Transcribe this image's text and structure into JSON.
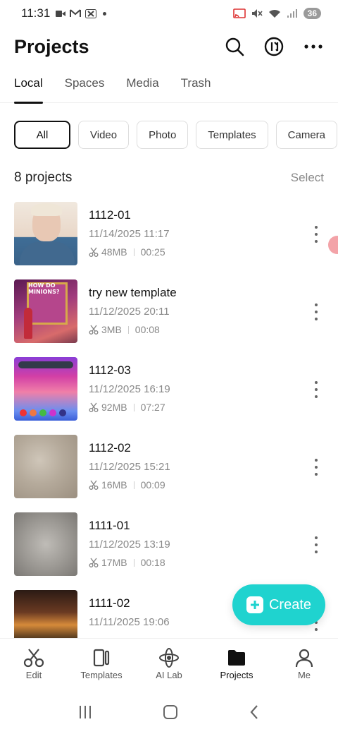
{
  "status_bar": {
    "time": "11:31",
    "left_icons": [
      "video-icon",
      "mail-icon",
      "x-icon",
      "dot-icon"
    ],
    "right_icons": [
      "cast-icon",
      "mute-icon",
      "wifi-icon",
      "signal-icon"
    ],
    "battery": "36"
  },
  "header": {
    "title": "Projects",
    "actions": [
      "search-icon",
      "sort-icon",
      "more-icon"
    ]
  },
  "tabs": [
    {
      "label": "Local",
      "active": true
    },
    {
      "label": "Spaces",
      "active": false
    },
    {
      "label": "Media",
      "active": false
    },
    {
      "label": "Trash",
      "active": false
    }
  ],
  "filters": [
    {
      "label": "All",
      "active": true
    },
    {
      "label": "Video",
      "active": false
    },
    {
      "label": "Photo",
      "active": false
    },
    {
      "label": "Templates",
      "active": false
    },
    {
      "label": "Camera",
      "active": false
    }
  ],
  "list": {
    "count_label": "8 projects",
    "select_label": "Select"
  },
  "projects": [
    {
      "name": "1112-01",
      "date": "11/14/2025 11:17",
      "size": "48MB",
      "duration": "00:25"
    },
    {
      "name": "try new template",
      "date": "11/12/2025 20:11",
      "size": "3MB",
      "duration": "00:08",
      "thumb_caption": "HOW DO MINIONS?"
    },
    {
      "name": "1112-03",
      "date": "11/12/2025 16:19",
      "size": "92MB",
      "duration": "07:27"
    },
    {
      "name": "1112-02",
      "date": "11/12/2025 15:21",
      "size": "16MB",
      "duration": "00:09"
    },
    {
      "name": "1111-01",
      "date": "11/12/2025 13:19",
      "size": "17MB",
      "duration": "00:18"
    },
    {
      "name": "1111-02",
      "date": "11/11/2025 19:06",
      "size": "",
      "duration": ""
    }
  ],
  "fab": {
    "label": "Create",
    "color": "#1fd3cf"
  },
  "bottom_nav": [
    {
      "label": "Edit",
      "icon": "scissors-icon",
      "active": false
    },
    {
      "label": "Templates",
      "icon": "templates-icon",
      "active": false
    },
    {
      "label": "AI Lab",
      "icon": "ai-lab-icon",
      "active": false
    },
    {
      "label": "Projects",
      "icon": "folder-icon",
      "active": true
    },
    {
      "label": "Me",
      "icon": "person-icon",
      "active": false
    }
  ],
  "system_nav": [
    "recents-icon",
    "home-icon",
    "back-icon"
  ]
}
